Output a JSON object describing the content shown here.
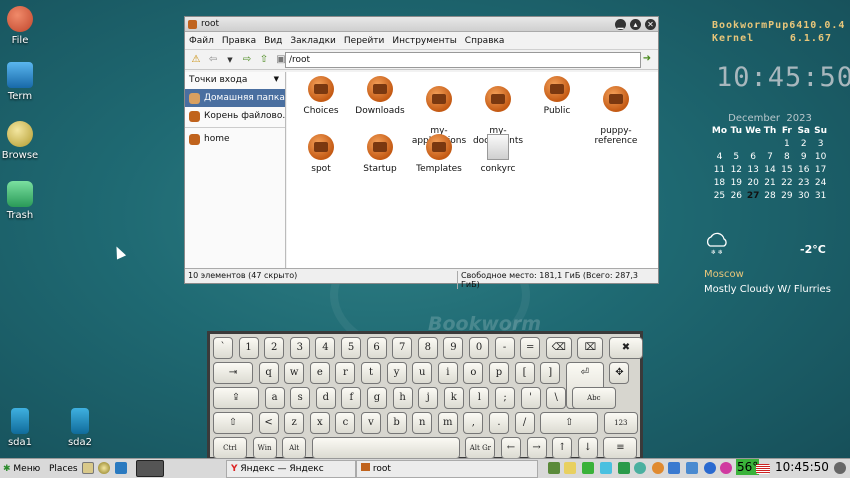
{
  "desktop": {
    "icons_left": [
      {
        "label": "File",
        "color": "#d0593a"
      },
      {
        "label": "Term",
        "color": "#1e88c6"
      },
      {
        "label": "Browse",
        "color": "#d8c24a"
      },
      {
        "label": "Trash",
        "color": "#3ab26a"
      }
    ],
    "drives": [
      {
        "label": "sda1"
      },
      {
        "label": "sda2"
      }
    ],
    "wallpaper_text": "Bookworm"
  },
  "file_manager": {
    "title": "root",
    "menu": [
      "Файл",
      "Правка",
      "Вид",
      "Закладки",
      "Перейти",
      "Инструменты",
      "Справка"
    ],
    "location": "/root",
    "sidebar": {
      "header": "Точки входа",
      "items": [
        {
          "label": "Домашняя папка",
          "selected": true
        },
        {
          "label": "Корень файлово..."
        },
        {
          "label": "home"
        }
      ]
    },
    "files": [
      {
        "name": "Choices",
        "kind": "folder",
        "link": false
      },
      {
        "name": "Downloads",
        "kind": "folder",
        "link": true
      },
      {
        "name": "my-\napplications",
        "kind": "folder",
        "link": false
      },
      {
        "name": "my-\ndocuments",
        "kind": "folder",
        "link": false
      },
      {
        "name": "Public",
        "kind": "folder",
        "link": false
      },
      {
        "name": "puppy-\nreference",
        "kind": "folder",
        "link": false
      },
      {
        "name": "spot",
        "kind": "folder",
        "link": true
      },
      {
        "name": "Startup",
        "kind": "folder",
        "link": false
      },
      {
        "name": "Templates",
        "kind": "folder",
        "link": false
      },
      {
        "name": "conkyrc",
        "kind": "document",
        "link": false
      }
    ],
    "status_left": "10 элементов (47 скрыто)",
    "status_right": "Свободное место: 181,1 ГиБ (Всего: 287,3 ГиБ)"
  },
  "conky": {
    "system_name": "BookwormPup64",
    "system_version": "10.0.4",
    "kernel_label": "Kernel",
    "kernel_version": "6.1.67",
    "time": "10:45:50",
    "calendar": {
      "month": "December",
      "year": "2023",
      "day_headers": [
        "Mo",
        "Tu",
        "We",
        "Th",
        "Fr",
        "Sa",
        "Su"
      ],
      "weeks": [
        [
          "",
          "",
          "",
          "",
          "1",
          "2",
          "3"
        ],
        [
          "4",
          "5",
          "6",
          "7",
          "8",
          "9",
          "10"
        ],
        [
          "11",
          "12",
          "13",
          "14",
          "15",
          "16",
          "17"
        ],
        [
          "18",
          "19",
          "20",
          "21",
          "22",
          "23",
          "24"
        ],
        [
          "25",
          "26",
          "27",
          "28",
          "29",
          "30",
          "31"
        ]
      ],
      "today": "27"
    },
    "weather": {
      "temperature": "-2°C",
      "city": "Moscow",
      "condition": "Mostly Cloudy W/ Flurries"
    }
  },
  "keyboard": {
    "rows": [
      [
        "`",
        "1",
        "2",
        "3",
        "4",
        "5",
        "6",
        "7",
        "8",
        "9",
        "0",
        "-",
        "=",
        "⌫",
        "⌧",
        "✖"
      ],
      [
        "⇥",
        "q",
        "w",
        "e",
        "r",
        "t",
        "y",
        "u",
        "i",
        "o",
        "p",
        "[",
        "]",
        "⏎",
        "✥"
      ],
      [
        "⇪",
        "a",
        "s",
        "d",
        "f",
        "g",
        "h",
        "j",
        "k",
        "l",
        ";",
        "'",
        "\\",
        "Abc"
      ],
      [
        "⇧",
        "<",
        "z",
        "x",
        "c",
        "v",
        "b",
        "n",
        "m",
        ",",
        ".",
        "/",
        "⇧",
        "123"
      ],
      [
        "Ctrl",
        "Win",
        "Alt",
        "",
        "Alt Gr",
        "←",
        "→",
        "↑",
        "↓",
        "≡"
      ]
    ]
  },
  "taskbar": {
    "menu_label": "Меню",
    "places_label": "Places",
    "tasks": [
      {
        "label": "Яндекс — Яндекс Браузер"
      },
      {
        "label": "root"
      }
    ],
    "temperature_badge": "56°",
    "clock": "10:45:50"
  }
}
